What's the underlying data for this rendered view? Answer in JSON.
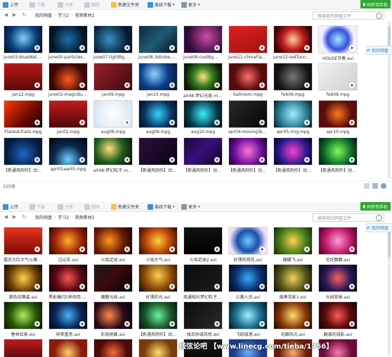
{
  "toolbar": {
    "upload": "上传",
    "download": "下载",
    "share": "分享",
    "delete": "删除",
    "new_folder": "新建文件夹",
    "offline_download": "离线下载",
    "more": "更多",
    "sync": "同步到手机"
  },
  "path": {
    "crumbs_top": [
      "我的网盘",
      "学习2",
      "视频素材2"
    ],
    "crumbs_bottom": [
      "我的网盘",
      "学习2",
      "视频素材2"
    ],
    "search_placeholder": "搜索我的网盘文件"
  },
  "top_files": [
    "june03-blueWater...",
    "june05-particles.mpg",
    "june07-lightBg.mpg",
    "june08-3stroke.mpg",
    "june09-coolBg.mpg",
    "june11-chinaFlag.m...",
    "june12-redTunnel...",
    "HOUSE节奏.avi",
    "jan12.mpg",
    "june02-magicBurst...",
    "jan09.mpg",
    "jan10.mpg",
    "a048-梦幻光斑.mov",
    "ballroom.mpg",
    "feb06.mpg",
    "feb08.mpg",
    "Flares&Trails.mpg",
    "jan02.mpg",
    "aug06.mpg",
    "aug09.mpg",
    "aug10.mpg",
    "apr04-movingText8...",
    "apr05-ring.mpg",
    "apr10.mpg",
    "【新通风制作】动态...",
    "apr03-earth.mpg",
    "a048-梦幻粒子.mp4",
    "【新通风制作】动态...",
    "【新通风制作】动态...",
    "【新通风制作】动态...",
    "【新通风制作】动态...",
    "【新通风制作】动态..."
  ],
  "bottom_files": [
    "喜庆大红大气火爆3.avi",
    "过山车.avi",
    "火焰足球.avi",
    "火焰大气.avi",
    "火焰足球2.avi",
    "好漂的霓花.avi",
    "蝴蝶飞.avi",
    "花纤飘飘.avi",
    "黄色炫舞姿.avi",
    "黑影爆闪5神场用.avi",
    "魔魅光线.avi",
    "好漂的光.avi",
    "周通相光梦幻粒子冠...",
    "公路人员.avi",
    "鼓奏花影1.avi",
    "光线背景.avi",
    "春林炫景.avi",
    "祥荣重亮.avi",
    "彩炮地面.avi",
    "【新通风制作】动态...",
    "烛旦异城风场.avi",
    "飞跃城港.avi",
    "花瓣风光.avi",
    "翻滚的城影.avi",
    "",
    "",
    "",
    "",
    "",
    "",
    "",
    ""
  ],
  "status": {
    "count": "155项"
  },
  "share_side": "我的网盘",
  "watermark": "线弦论吧 【www.linecg.com/tieba/1756】",
  "colors": {
    "accent": "#2fa62f",
    "toolbar_bg": "#f4f6f8"
  }
}
